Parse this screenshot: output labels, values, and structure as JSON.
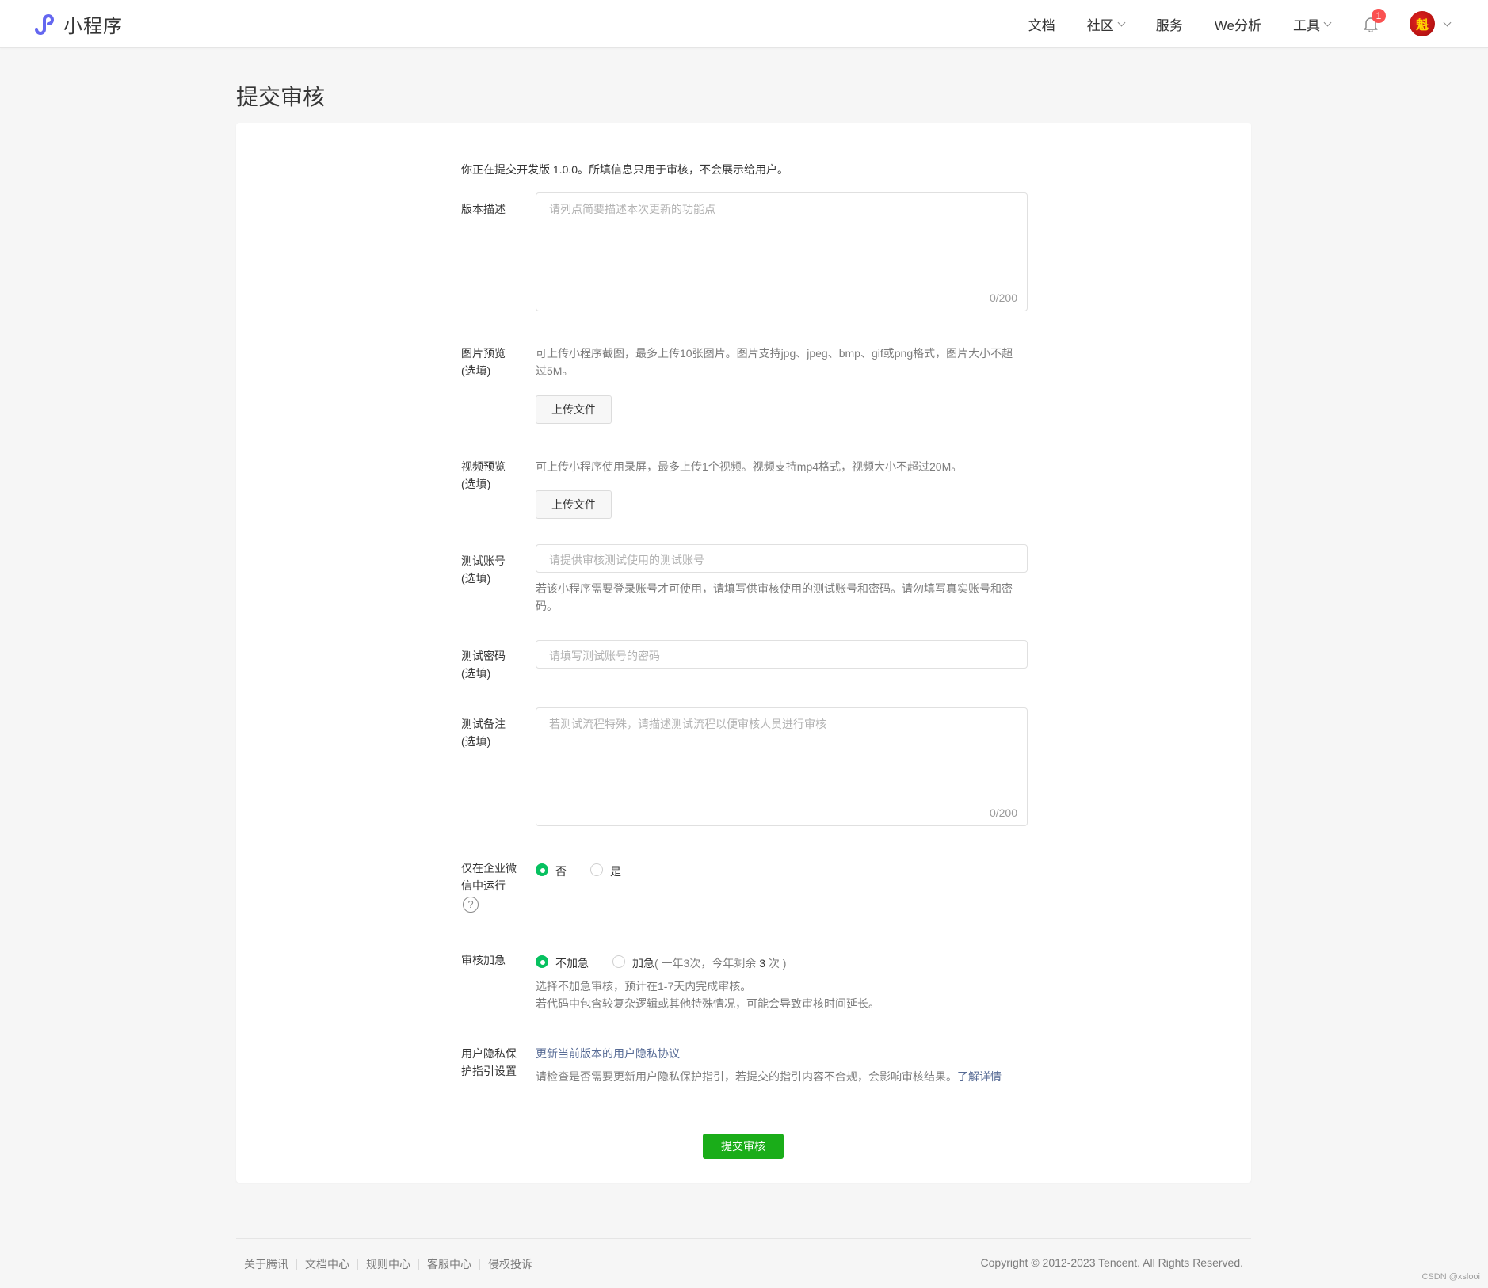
{
  "header": {
    "logo_text": "小程序",
    "nav": [
      {
        "label": "文档",
        "has_dropdown": false
      },
      {
        "label": "社区",
        "has_dropdown": true
      },
      {
        "label": "服务",
        "has_dropdown": false
      },
      {
        "label": "We分析",
        "has_dropdown": false
      },
      {
        "label": "工具",
        "has_dropdown": true
      }
    ],
    "notification_count": "1",
    "avatar_text": "魁"
  },
  "page": {
    "title": "提交审核"
  },
  "form": {
    "intro": "你正在提交开发版 1.0.0。所填信息只用于审核，不会展示给用户。",
    "version_desc": {
      "label": "版本描述",
      "placeholder": "请列点简要描述本次更新的功能点",
      "counter": "0/200"
    },
    "image_preview": {
      "label_line1": "图片预览",
      "label_line2": "(选填)",
      "hint_line1": "可上传小程序截图，最多上传10张图片。图片支持jpg、jpeg、bmp、gif或png格式，图片大小不超",
      "hint_line2": "过5M。",
      "button": "上传文件"
    },
    "video_preview": {
      "label_line1": "视频预览",
      "label_line2": "(选填)",
      "hint": "可上传小程序使用录屏，最多上传1个视频。视频支持mp4格式，视频大小不超过20M。",
      "button": "上传文件"
    },
    "test_account": {
      "label_line1": "测试账号",
      "label_line2": "(选填)",
      "placeholder": "请提供审核测试使用的测试账号",
      "hint_line1": "若该小程序需要登录账号才可使用，请填写供审核使用的测试账号和密码。请勿填写真实账号和密",
      "hint_line2": "码。"
    },
    "test_password": {
      "label_line1": "测试密码",
      "label_line2": "(选填)",
      "placeholder": "请填写测试账号的密码"
    },
    "test_notes": {
      "label_line1": "测试备注",
      "label_line2": "(选填)",
      "placeholder": "若测试流程特殊，请描述测试流程以便审核人员进行审核",
      "counter": "0/200"
    },
    "wecom_only": {
      "label_line1": "仅在企业微",
      "label_line2": "信中运行",
      "help": "?",
      "options": [
        "否",
        "是"
      ],
      "selected": "否"
    },
    "expedite": {
      "label": "审核加急",
      "option_no": "不加急",
      "option_yes": "加急",
      "quota_prefix": "( 一年3次，今年剩余 ",
      "quota_remaining": "3",
      "quota_suffix": " 次 )",
      "selected": "不加急",
      "hint_line1": "选择不加急审核，预计在1-7天内完成审核。",
      "hint_line2": "若代码中包含较复杂逻辑或其他特殊情况，可能会导致审核时间延长。"
    },
    "privacy": {
      "label_line1": "用户隐私保",
      "label_line2": "护指引设置",
      "update_link": "更新当前版本的用户隐私协议",
      "hint": "请检查是否需要更新用户隐私保护指引，若提交的指引内容不合规，会影响审核结果。",
      "details_link": "了解详情"
    },
    "submit": "提交审核"
  },
  "footer": {
    "links": [
      "关于腾讯",
      "文档中心",
      "规则中心",
      "客服中心",
      "侵权投诉"
    ],
    "copyright": "Copyright © 2012-2023 Tencent. All Rights Reserved."
  },
  "watermark": "CSDN @xslooi",
  "colors": {
    "accent_green": "#07c160",
    "submit_green": "#1aad19",
    "link_blue": "#576b95",
    "badge_red": "#fa5151"
  }
}
